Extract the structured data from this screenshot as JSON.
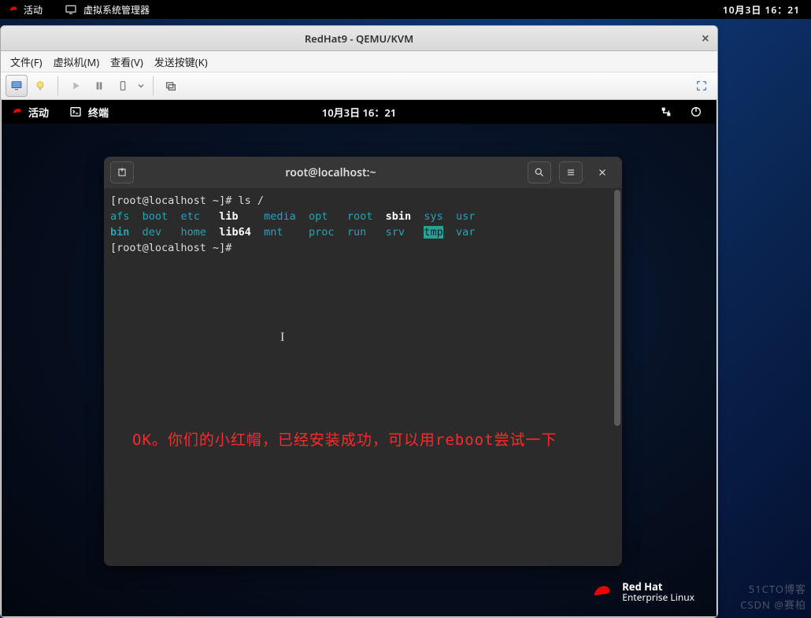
{
  "host_topbar": {
    "activities": "活动",
    "vmm_label": "虚拟系统管理器",
    "time": "10月3日 16：21"
  },
  "vm_window": {
    "title": "RedHat9 - QEMU/KVM",
    "close_glyph": "×",
    "menu": {
      "file": "文件(F)",
      "vm": "虚拟机(M)",
      "view": "查看(V)",
      "send_keys": "发送按键(K)"
    }
  },
  "guest_topbar": {
    "activities": "活动",
    "terminal_label": "终端",
    "time": "10月3日 16：21"
  },
  "terminal": {
    "title": "root@localhost:~",
    "prompt1": "[root@localhost ~]# ls  /",
    "row1": {
      "afs": "afs",
      "boot": "boot",
      "etc": "etc",
      "lib": "lib",
      "media": "media",
      "opt": "opt",
      "root": "root",
      "sbin": "sbin",
      "sys": "sys",
      "usr": "usr"
    },
    "row2": {
      "bin": "bin",
      "dev": "dev",
      "home": "home",
      "lib64": "lib64",
      "mnt": "mnt",
      "proc": "proc",
      "run": "run",
      "srv": "srv",
      "tmp": "tmp",
      "var": "var"
    },
    "prompt2": "[root@localhost ~]# "
  },
  "annotation": "OK。你们的小红帽，已经安装成功，可以用reboot尝试一下",
  "brand": {
    "line1": "Red Hat",
    "line2": "Enterprise Linux"
  },
  "watermark": "CSDN @赛柏",
  "watermark2": "51CTO博客"
}
